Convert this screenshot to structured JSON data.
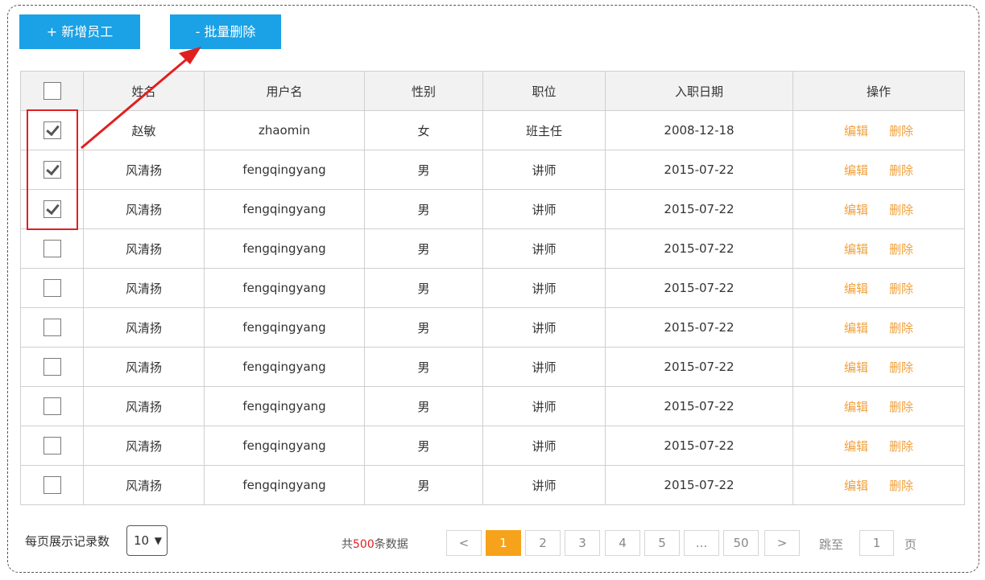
{
  "toolbar": {
    "add_label": "+ 新增员工",
    "batch_delete_label": "- 批量删除"
  },
  "table": {
    "headers": [
      "姓名",
      "用户名",
      "性别",
      "职位",
      "入职日期",
      "操作"
    ],
    "rows": [
      {
        "checked": true,
        "name": "赵敏",
        "username": "zhaomin",
        "gender": "女",
        "position": "班主任",
        "date": "2008-12-18"
      },
      {
        "checked": true,
        "name": "风清扬",
        "username": "fengqingyang",
        "gender": "男",
        "position": "讲师",
        "date": "2015-07-22"
      },
      {
        "checked": true,
        "name": "风清扬",
        "username": "fengqingyang",
        "gender": "男",
        "position": "讲师",
        "date": "2015-07-22"
      },
      {
        "checked": false,
        "name": "风清扬",
        "username": "fengqingyang",
        "gender": "男",
        "position": "讲师",
        "date": "2015-07-22"
      },
      {
        "checked": false,
        "name": "风清扬",
        "username": "fengqingyang",
        "gender": "男",
        "position": "讲师",
        "date": "2015-07-22"
      },
      {
        "checked": false,
        "name": "风清扬",
        "username": "fengqingyang",
        "gender": "男",
        "position": "讲师",
        "date": "2015-07-22"
      },
      {
        "checked": false,
        "name": "风清扬",
        "username": "fengqingyang",
        "gender": "男",
        "position": "讲师",
        "date": "2015-07-22"
      },
      {
        "checked": false,
        "name": "风清扬",
        "username": "fengqingyang",
        "gender": "男",
        "position": "讲师",
        "date": "2015-07-22"
      },
      {
        "checked": false,
        "name": "风清扬",
        "username": "fengqingyang",
        "gender": "男",
        "position": "讲师",
        "date": "2015-07-22"
      },
      {
        "checked": false,
        "name": "风清扬",
        "username": "fengqingyang",
        "gender": "男",
        "position": "讲师",
        "date": "2015-07-22"
      }
    ],
    "edit_label": "编辑",
    "delete_label": "删除"
  },
  "footer": {
    "page_size_label": "每页展示记录数",
    "page_size": "10",
    "total_prefix": "共",
    "total_count": "500",
    "total_suffix": "条数据",
    "pages": [
      "<",
      "1",
      "2",
      "3",
      "4",
      "5",
      "...",
      "50",
      ">"
    ],
    "current_page": "1",
    "jump_label": "跳至",
    "jump_value": "1",
    "page_unit": "页"
  },
  "colors": {
    "primary": "#1aa1e6",
    "accent": "#f7a21b",
    "link": "#f0a03c",
    "annotation": "#e02020"
  }
}
